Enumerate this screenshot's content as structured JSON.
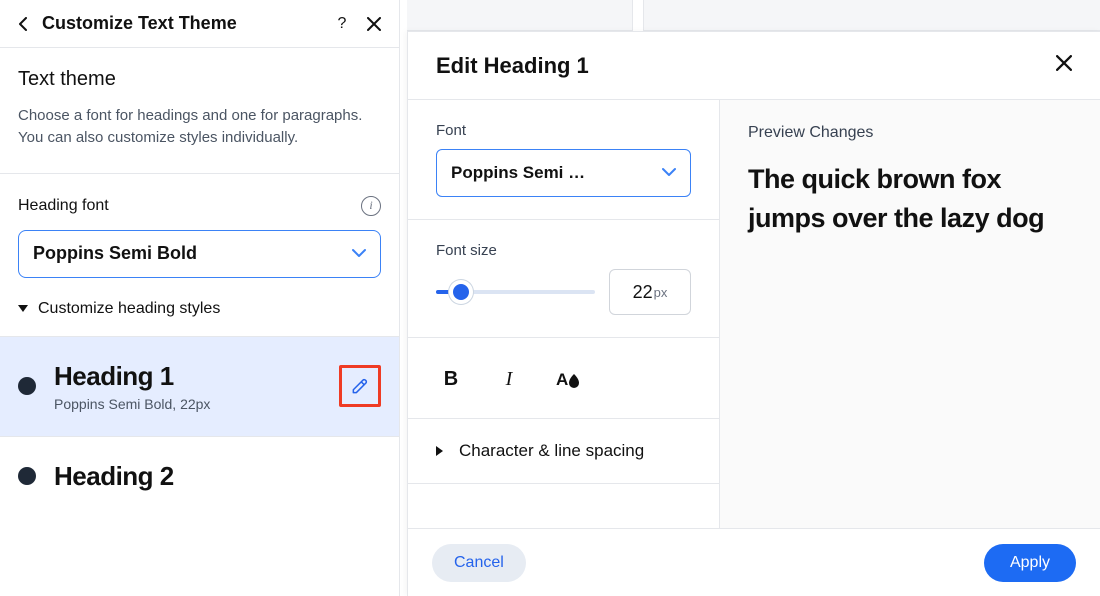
{
  "leftPanel": {
    "title": "Customize Text Theme",
    "sectionTitle": "Text theme",
    "description": "Choose a font for headings and one for paragraphs. You can also customize styles individually.",
    "headingFontLabel": "Heading font",
    "headingFontValue": "Poppins Semi Bold",
    "customizeToggle": "Customize heading styles",
    "headings": [
      {
        "title": "Heading 1",
        "meta": "Poppins Semi Bold, 22px"
      },
      {
        "title": "Heading 2",
        "meta": ""
      }
    ]
  },
  "rightPanel": {
    "title": "Edit Heading 1",
    "fontLabel": "Font",
    "fontValue": "Poppins Semi …",
    "fontSizeLabel": "Font size",
    "fontSizeValue": "22",
    "fontSizeUnit": "px",
    "spacingLabel": "Character & line spacing",
    "previewLabel": "Preview Changes",
    "previewText": "The quick brown fox jumps over the lazy dog",
    "cancel": "Cancel",
    "apply": "Apply"
  }
}
